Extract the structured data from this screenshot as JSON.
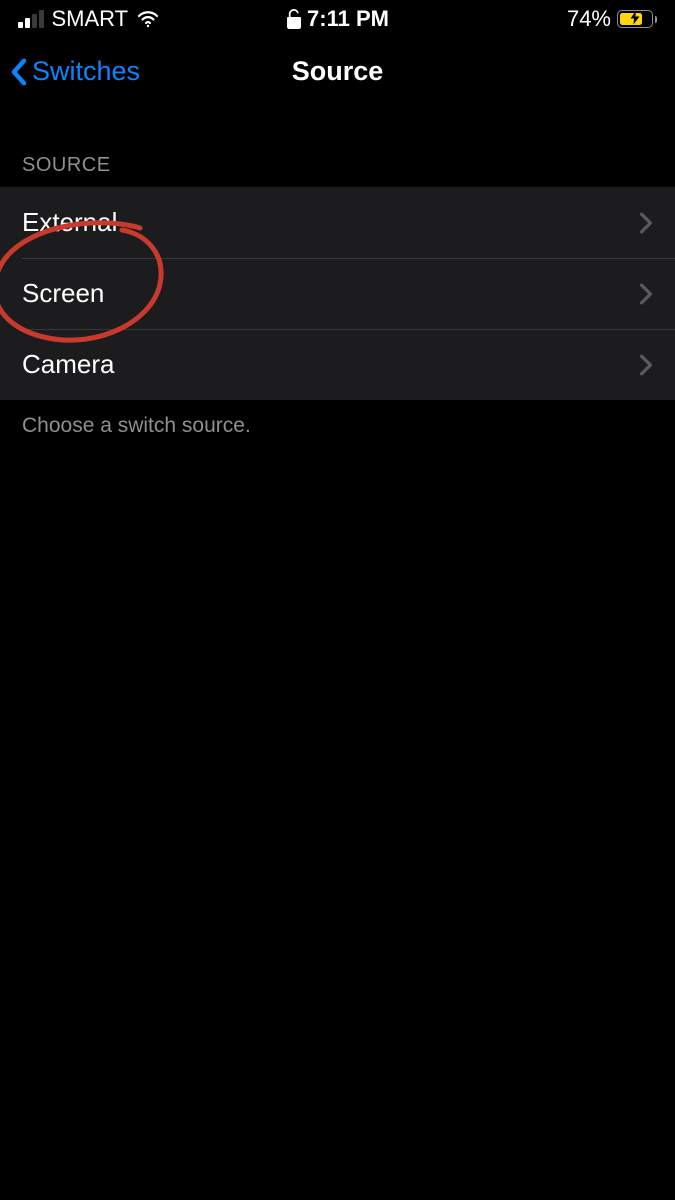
{
  "status": {
    "carrier": "SMART",
    "time": "7:11 PM",
    "battery_percent": "74%",
    "battery_fill_percent": 74
  },
  "nav": {
    "back_label": "Switches",
    "title": "Source"
  },
  "section": {
    "header": "Source",
    "footer": "Choose a switch source.",
    "rows": [
      {
        "label": "External"
      },
      {
        "label": "Screen"
      },
      {
        "label": "Camera"
      }
    ]
  },
  "annotation": {
    "color": "#c83a2e",
    "target": "row-screen"
  }
}
